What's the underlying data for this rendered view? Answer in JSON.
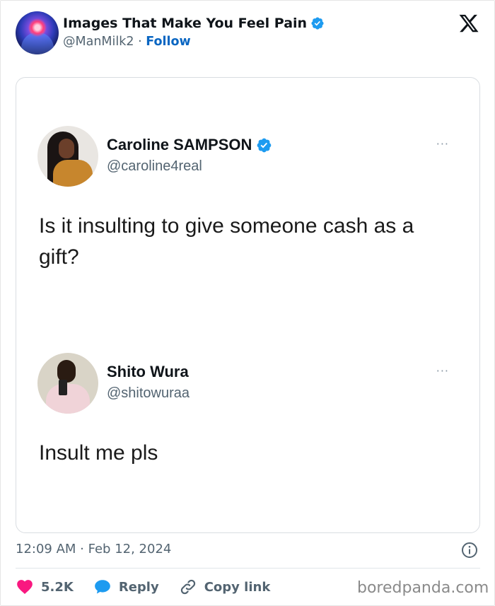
{
  "header": {
    "display_name": "Images That Make You Feel Pain",
    "handle": "@ManMilk2",
    "separator": "·",
    "follow_label": "Follow"
  },
  "embedded": {
    "tweets": [
      {
        "name": "Caroline SAMPSON",
        "handle": "@caroline4real",
        "verified": true,
        "text": "Is it insulting to give someone cash as a gift?",
        "more": "···"
      },
      {
        "name": "Shito Wura",
        "handle": "@shitowuraa",
        "verified": false,
        "text": "Insult me pls",
        "more": "···"
      }
    ]
  },
  "meta": {
    "timestamp": "12:09 AM · Feb 12, 2024"
  },
  "actions": {
    "likes": "5.2K",
    "reply": "Reply",
    "copy_link": "Copy link"
  },
  "watermark": "boredpanda.com",
  "colors": {
    "verified_blue": "#1d9bf0",
    "follow_blue": "#0a66c2",
    "heart_red": "#f91880",
    "reply_blue": "#1d9bf0",
    "secondary_text": "#536471"
  }
}
